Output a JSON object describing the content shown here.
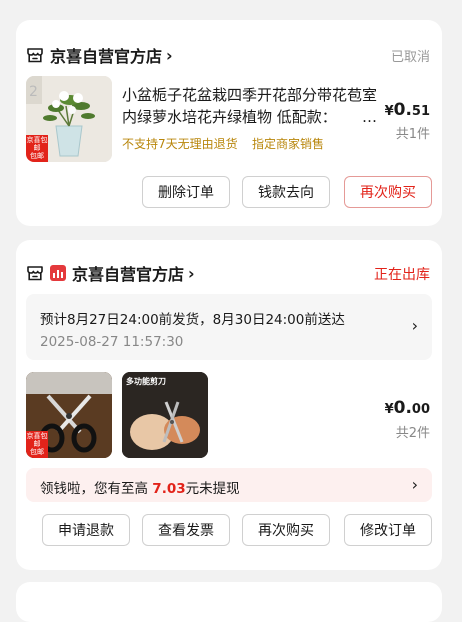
{
  "order1": {
    "shop_name": "京喜自营官方店",
    "status": "已取消",
    "product_title": "小盆栀子花盆栽四季开花部分带花苞室内绿萝水培花卉绿植物 低配款：",
    "ellipsis": "…",
    "note_return": "不支持7天无理由退货",
    "note_seller": "指定商家销售",
    "price_symbol": "¥",
    "price_main": "0.",
    "price_cents": "51",
    "quantity": "共1件",
    "tag_line1": "京喜包邮",
    "tag_line2": "包邮",
    "buttons": {
      "delete": "删除订单",
      "money_flow": "钱款去向",
      "rebuy": "再次购买"
    }
  },
  "order2": {
    "shop_name": "京喜自营官方店",
    "status": "正在出库",
    "delivery_text": "预计8月27日24:00前发货，8月30日24:00前送达",
    "order_time": "2025-08-27 11:57:30",
    "item2_label": "多功能剪刀",
    "price_symbol": "¥",
    "price_main": "0.",
    "price_cents": "00",
    "quantity": "共2件",
    "tag_line1": "京喜包邮",
    "tag_line2": "包邮",
    "cash_prefix": "领钱啦，您有至高",
    "cash_amount": "7.03",
    "cash_suffix": "元未提现",
    "buttons": {
      "refund": "申请退款",
      "invoice": "查看发票",
      "rebuy": "再次购买",
      "modify": "修改订单"
    }
  },
  "colors": {
    "accent_red": "#e2231a",
    "note_gold": "#b8860b",
    "muted": "#999999"
  },
  "icons": [
    "store-icon",
    "jd-logo-icon",
    "chevron-right-icon"
  ]
}
